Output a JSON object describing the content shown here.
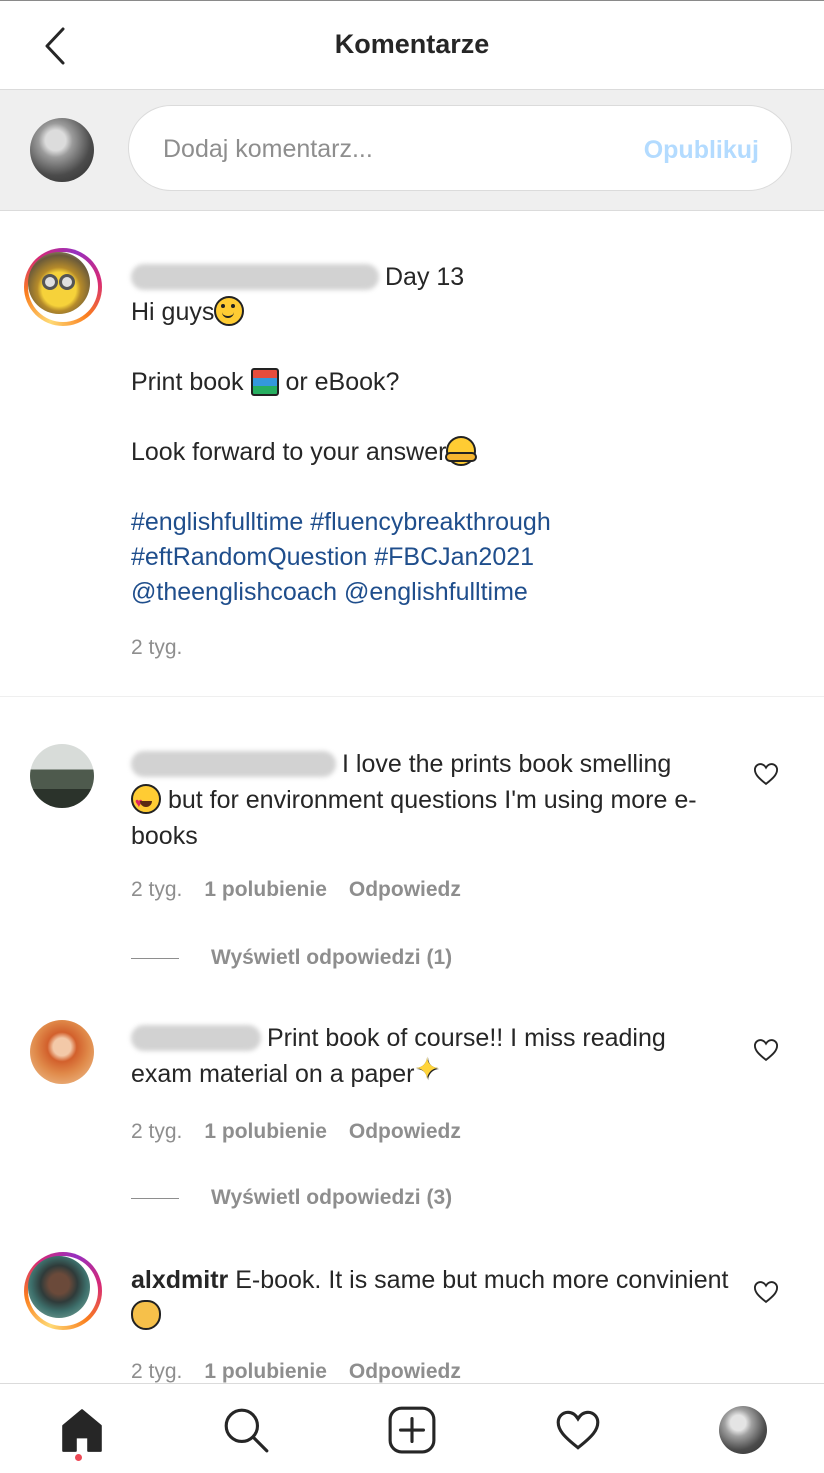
{
  "header": {
    "title": "Komentarze"
  },
  "composer": {
    "placeholder": "Dodaj komentarz...",
    "publish_label": "Opublikuj"
  },
  "caption": {
    "lines": [
      "Day 13",
      "Hi guys",
      "Print book",
      "or eBook?",
      "Look forward to your answer"
    ],
    "hashtags": [
      "#englishfulltime",
      "#fluencybreakthrough",
      "#eftRandomQuestion",
      "#FBCJan2021"
    ],
    "mentions": [
      "@theenglishcoach",
      "@englishfulltime"
    ],
    "time": "2 tyg."
  },
  "comments": [
    {
      "text_a": "I love the prints book smelling",
      "text_b": "but for environment questions I'm using more e-books",
      "time": "2 tyg.",
      "likes": "1 polubienie",
      "reply": "Odpowiedz",
      "view_replies": "Wyświetl odpowiedzi (1)"
    },
    {
      "text_a": "Print book of course!! I miss reading exam material on a paper",
      "time": "2 tyg.",
      "likes": "1 polubienie",
      "reply": "Odpowiedz",
      "view_replies": "Wyświetl odpowiedzi (3)"
    },
    {
      "username": "alxdmitr",
      "text_a": "E-book. It is same but much more convinient",
      "time": "2 tyg.",
      "likes": "1 polubienie",
      "reply": "Odpowiedz"
    }
  ],
  "nav": {
    "icons": [
      "home-icon",
      "search-icon",
      "new-post-icon",
      "activity-heart-icon",
      "profile-avatar"
    ]
  },
  "colors": {
    "link": "#1f4e8c",
    "meta": "#8e8e8e",
    "publish_disabled": "#b3dbff",
    "notification": "#ed4956"
  }
}
